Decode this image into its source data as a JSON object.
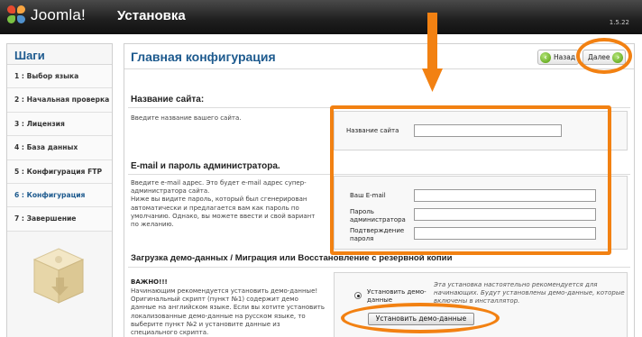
{
  "header": {
    "logo_text": "Joomla!",
    "title": "Установка",
    "version": "1.5.22"
  },
  "sidebar": {
    "title": "Шаги",
    "items": [
      {
        "label": "1 : Выбор языка",
        "active": false
      },
      {
        "label": "2 : Начальная проверка",
        "active": false
      },
      {
        "label": "3 : Лицензия",
        "active": false
      },
      {
        "label": "4 : База данных",
        "active": false
      },
      {
        "label": "5 : Конфигурация FTP",
        "active": false
      },
      {
        "label": "6 : Конфигурация",
        "active": true
      },
      {
        "label": "7 : Завершение",
        "active": false
      }
    ]
  },
  "main": {
    "title": "Главная конфигурация",
    "back_label": "Назад",
    "next_label": "Далее",
    "site_name": {
      "heading": "Название сайта:",
      "description": "Введите название вашего сайта.",
      "field_label": "Название сайта",
      "value": ""
    },
    "admin": {
      "heading": "E-mail и пароль администратора.",
      "description": "Введите e-mail адрес. Это будет e-mail адрес супер-администратора сайта.\nНиже вы видите пароль, который был сгенерирован автоматически и предлагается вам как пароль по умолчанию. Однако, вы можете ввести и свой вариант по желанию.",
      "email_label": "Ваш E-mail",
      "password_label": "Пароль администратора",
      "confirm_label": "Подтверждение пароля"
    },
    "demo": {
      "heading": "Загрузка демо-данных / Миграция или Восстановление с резервной копии",
      "important": "ВАЖНО!!!",
      "description": "Начинающим рекомендуется установить демо-данные! Оригинальный скрипт (пункт №1) содержит демо данные на английском языке. Если вы хотите установить локализованные демо-данные на русском языке, то выберите пункт №2 и установите данные из специального скрипта.",
      "radio_label": "Установить демо-данные",
      "install_button": "Установить демо-данные",
      "note": "Эта установка настоятельно рекомендуется для начинающих. Будут установлены демо-данные, которые включены в инсталлятор."
    }
  },
  "colors": {
    "accent": "#1d5a8e",
    "annotation": "#f28112",
    "header_bg": "#1e1e1e"
  }
}
